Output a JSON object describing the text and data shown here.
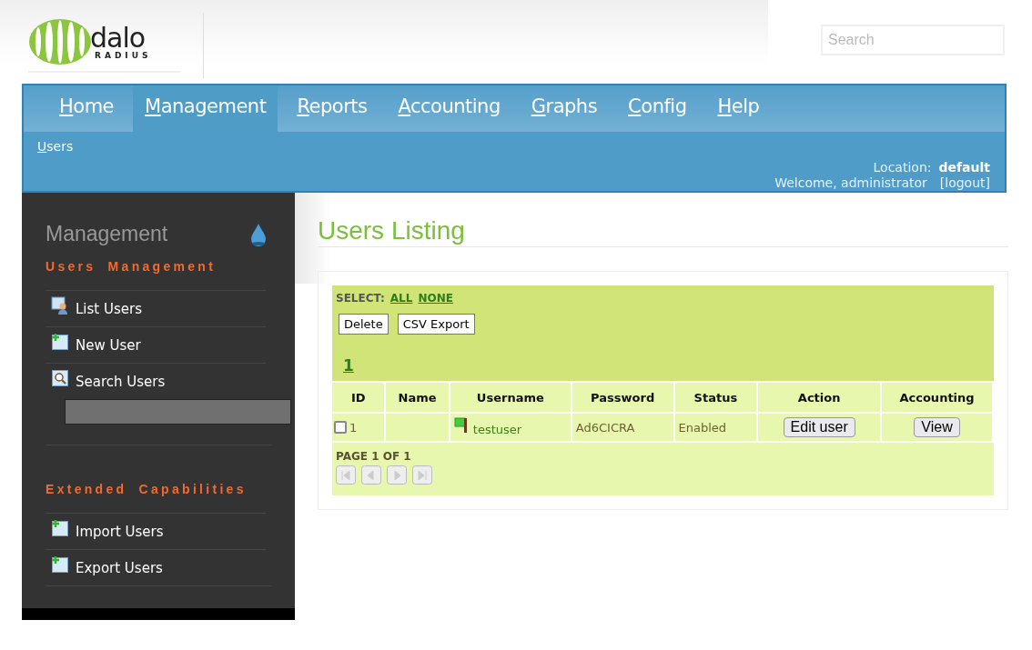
{
  "logo": {
    "word": "dalo",
    "subword": "RADIUS"
  },
  "search": {
    "placeholder": "Search"
  },
  "nav": [
    {
      "label": "Home",
      "selected": false
    },
    {
      "label": "Management",
      "selected": true
    },
    {
      "label": "Reports",
      "selected": false
    },
    {
      "label": "Accounting",
      "selected": false
    },
    {
      "label": "Graphs",
      "selected": false
    },
    {
      "label": "Config",
      "selected": false
    },
    {
      "label": "Help",
      "selected": false
    }
  ],
  "subnav": [
    {
      "label": "Users"
    }
  ],
  "location": {
    "label": "Location:",
    "value": "default"
  },
  "welcome": {
    "text": "Welcome, administrator",
    "logout": "[logout]"
  },
  "sidebar": {
    "title": "Management",
    "sections": [
      {
        "heading": "Users Management",
        "has_search_field": true,
        "items": [
          {
            "label": "List Users",
            "kind": "users"
          },
          {
            "label": "New User",
            "kind": "add"
          },
          {
            "label": "Search Users",
            "kind": "search"
          }
        ]
      },
      {
        "heading": "Extended Capabilities",
        "has_search_field": false,
        "items": [
          {
            "label": "Import Users",
            "kind": "add"
          },
          {
            "label": "Export Users",
            "kind": "add"
          }
        ]
      }
    ]
  },
  "main": {
    "title": "Users Listing",
    "select_label": "SELECT:",
    "select_links": [
      "ALL",
      "NONE"
    ],
    "buttons": [
      "Delete",
      "CSV Export"
    ],
    "pages": [
      "1"
    ],
    "table": {
      "columns": [
        "ID",
        "Name",
        "Username",
        "Password",
        "Status",
        "Action",
        "Accounting"
      ],
      "rows": [
        {
          "checked": false,
          "id": "1",
          "username": "testuser",
          "password": "Ad6CICRA",
          "status": "Enabled",
          "action": "Edit user",
          "accounting": "View"
        }
      ]
    },
    "pager": "PAGE 1 OF 1"
  }
}
